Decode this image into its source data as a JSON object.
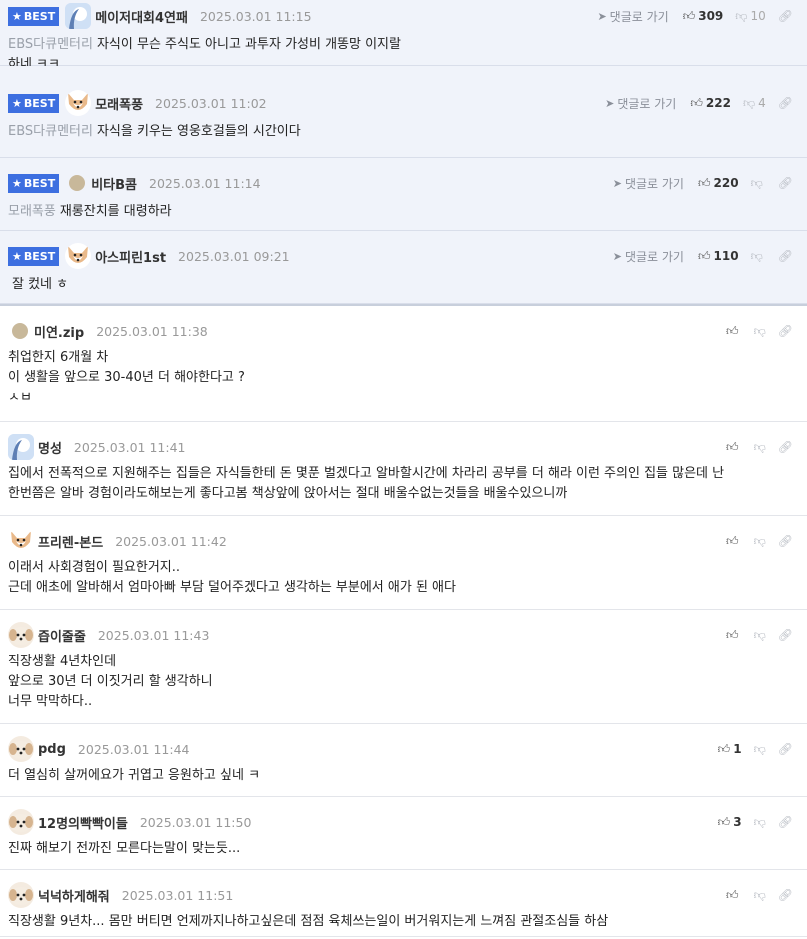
{
  "badge_label": "BEST",
  "reply_label": "댓글로 가기",
  "best_comments": [
    {
      "nick": "메이저대회4연패",
      "date": "2025.03.01 11:15",
      "up": "309",
      "down": "10",
      "quote": "EBS다큐멘터리",
      "lines": [
        "자식이 무슨 주식도 아니고 과투자 가성비 개똥망 이지랄",
        "하네 ㅋㅋ"
      ]
    },
    {
      "nick": "모래폭풍",
      "date": "2025.03.01 11:02",
      "up": "222",
      "down": "4",
      "quote": "EBS다큐멘터리",
      "lines": [
        "자식을 키우는 영웅호걸들의 시간이다"
      ]
    },
    {
      "nick": "비타B콤",
      "date": "2025.03.01 11:14",
      "up": "220",
      "down": "",
      "quote": "모래폭풍",
      "lines": [
        "재롱잔치를 대령하라"
      ]
    },
    {
      "nick": "아스피린1st",
      "date": "2025.03.01 09:21",
      "up": "110",
      "down": "",
      "quote": "",
      "lines": [
        "잘 컸네 ㅎ"
      ]
    }
  ],
  "comments": [
    {
      "nick": "미연.zip",
      "date": "2025.03.01 11:38",
      "up": "",
      "lines": [
        "취업한지 6개월 차",
        "이 생활을 앞으로 30-40년 더 해야한다고 ?",
        "ㅅㅂ"
      ]
    },
    {
      "nick": "명성",
      "date": "2025.03.01 11:41",
      "up": "",
      "lines": [
        "집에서 전폭적으로 지원해주는 집들은 자식들한테 돈 몇푼 벌겠다고 알바할시간에 차라리 공부를 더 해라 이런 주의인 집들 많은데 난",
        "한번쯤은 알바 경험이라도해보는게 좋다고봄 책상앞에 앉아서는 절대 배울수없는것들을 배울수있으니까"
      ]
    },
    {
      "nick": "프리렌-본드",
      "date": "2025.03.01 11:42",
      "up": "",
      "lines": [
        "이래서 사회경험이 필요한거지..",
        "근데 애초에 알바해서 엄마아빠 부담 덜어주겠다고 생각하는 부분에서 애가 된 애다"
      ]
    },
    {
      "nick": "즙이줄줄",
      "date": "2025.03.01 11:43",
      "up": "",
      "lines": [
        "직장생활 4년차인데",
        "앞으로 30년 더 이짓거리 할 생각하니",
        "너무 막막하다.."
      ]
    },
    {
      "nick": "pdg",
      "date": "2025.03.01 11:44",
      "up": "1",
      "lines": [
        "더 열심히 살꺼에요가 귀엽고 응원하고 싶네 ㅋ"
      ]
    },
    {
      "nick": "12명의빡빡이들",
      "date": "2025.03.01 11:50",
      "up": "3",
      "lines": [
        "진짜 해보기 전까진 모른다는말이 맞는듯..."
      ]
    },
    {
      "nick": "넉넉하게해줘",
      "date": "2025.03.01 11:51",
      "up": "",
      "lines": [
        "직장생활 9년차... 몸만 버티면 언제까지나하고싶은데 점점 육체쓰는일이 버거워지는게 느껴짐 관절조심들 하삼"
      ]
    }
  ]
}
